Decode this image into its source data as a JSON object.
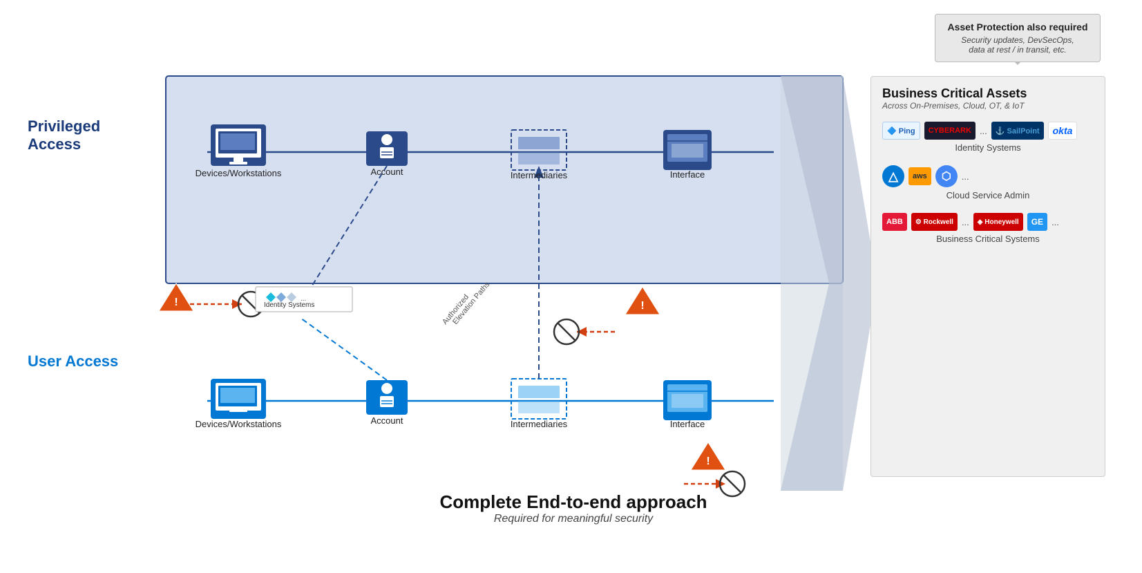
{
  "tooltip": {
    "title": "Asset Protection also required",
    "subtitle": "Security updates, DevSecOps,\ndata at rest / in transit, etc."
  },
  "privileged_access": {
    "label": "Privileged Access"
  },
  "user_access": {
    "label": "User Access"
  },
  "priv_nodes": [
    {
      "id": "priv-devices",
      "label": "Devices/Workstations"
    },
    {
      "id": "priv-account",
      "label": "Account"
    },
    {
      "id": "priv-intermediaries",
      "label": "Intermediaries"
    },
    {
      "id": "priv-interface",
      "label": "Interface"
    }
  ],
  "user_nodes": [
    {
      "id": "user-devices",
      "label": "Devices/Workstations"
    },
    {
      "id": "user-account",
      "label": "Account"
    },
    {
      "id": "user-intermediaries",
      "label": "Intermediaries"
    },
    {
      "id": "user-interface",
      "label": "Interface"
    }
  ],
  "identity_popup": {
    "label": "Identity Systems"
  },
  "elevation_label": "Authorized\nElevation Paths",
  "assets": {
    "title": "Business Critical Assets",
    "subtitle": "Across On-Premises, Cloud, OT, & IoT",
    "sections": [
      {
        "name": "Identity Systems",
        "logos": [
          "Ping",
          "CYBERARK",
          "SailPoint",
          "okta",
          "..."
        ]
      },
      {
        "name": "Cloud Service Admin",
        "logos": [
          "Azure",
          "aws",
          "GCP",
          "..."
        ]
      },
      {
        "name": "Business Critical Systems",
        "logos": [
          "ABB",
          "Rockwell",
          "Honeywell",
          "GE",
          "..."
        ]
      }
    ]
  },
  "bottom": {
    "main": "Complete End-to-end approach",
    "sub": "Required for meaningful security"
  }
}
